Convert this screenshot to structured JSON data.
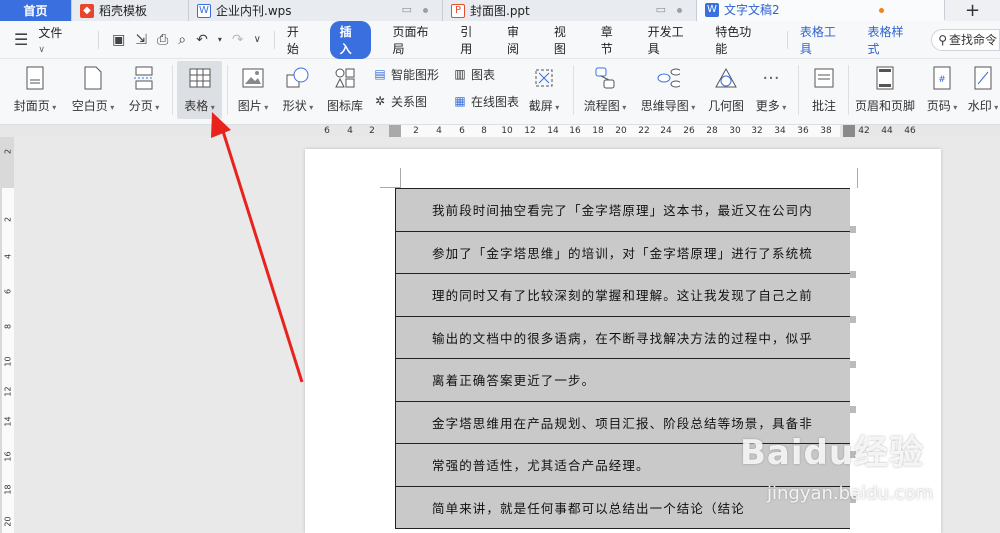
{
  "tabs": [
    {
      "label": "首页",
      "icon": "home"
    },
    {
      "label": "稻壳模板",
      "icon": "docer-icon"
    },
    {
      "label": "企业内刊.wps",
      "icon": "wps-doc-icon"
    },
    {
      "label": "封面图.ppt",
      "icon": "ppt-icon"
    },
    {
      "label": "文字文稿2",
      "icon": "wps-doc-icon"
    }
  ],
  "menu": {
    "file": "文件",
    "items": [
      "开始",
      "插入",
      "页面布局",
      "引用",
      "审阅",
      "视图",
      "章节",
      "开发工具",
      "特色功能"
    ],
    "active": "插入",
    "context": [
      "表格工具",
      "表格样式"
    ],
    "search": "查找命令"
  },
  "ribbon": {
    "cover": "封面页",
    "blank": "空白页",
    "pagebreak": "分页",
    "table": "表格",
    "picture": "图片",
    "shape": "形状",
    "iconlib": "图标库",
    "smartart": "智能图形",
    "chart": "图表",
    "relation": "关系图",
    "onlinechart": "在线图表",
    "screenshot": "截屏",
    "flow": "流程图",
    "mindmap": "思维导图",
    "geometry": "几何图",
    "more": "更多",
    "comment": "批注",
    "headerfooter": "页眉和页脚",
    "pagenum": "页码",
    "watermark": "水印"
  },
  "ruler": {
    "h": [
      "6",
      "4",
      "2",
      "2",
      "4",
      "6",
      "8",
      "10",
      "12",
      "14",
      "16",
      "18",
      "20",
      "22",
      "24",
      "26",
      "28",
      "30",
      "32",
      "34",
      "36",
      "38",
      "42",
      "44",
      "46"
    ],
    "v": [
      "2",
      "2",
      "4",
      "6",
      "8",
      "10",
      "12",
      "14",
      "16",
      "18",
      "20"
    ]
  },
  "document": {
    "rows": [
      "我前段时间抽空看完了「金字塔原理」这本书，最近又在公司内",
      "参加了「金字塔思维」的培训，对「金字塔原理」进行了系统梳",
      "理的同时又有了比较深刻的掌握和理解。这让我发现了自己之前",
      "输出的文档中的很多语病，在不断寻找解决方法的过程中，似乎",
      "离着正确答案更近了一步。",
      "金字塔思维用在产品规划、项目汇报、阶段总结等场景，具备非",
      "常强的普适性，尤其适合产品经理。",
      "简单来讲，就是任何事都可以总结出一个结论（结论"
    ]
  },
  "watermark": {
    "brand": "Baidu经验",
    "url": "jingyan.baidu.com"
  }
}
